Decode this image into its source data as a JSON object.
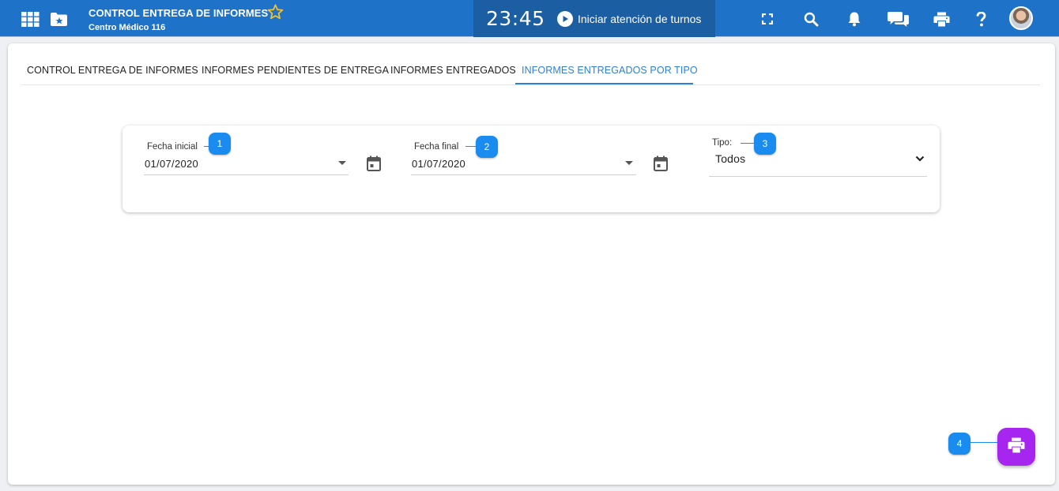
{
  "header": {
    "title": "CONTROL ENTREGA DE INFORMES",
    "subtitle": "Centro Médico 116",
    "clock": "23:45",
    "turnos_label": "Iniciar atención de turnos",
    "icons": [
      "apps-grid-icon",
      "folder-star-icon",
      "favorite-star-icon",
      "play-icon",
      "fullscreen-icon",
      "search-icon",
      "bell-icon",
      "chat-icon",
      "print-icon",
      "help-icon"
    ]
  },
  "tabs": [
    {
      "label": "CONTROL ENTREGA DE INFORMES",
      "active": false
    },
    {
      "label": "INFORMES PENDIENTES DE ENTREGA",
      "active": false
    },
    {
      "label": "INFORMES ENTREGADOS",
      "active": false
    },
    {
      "label": "INFORMES ENTREGADOS POR TIPO",
      "active": true
    }
  ],
  "filters": {
    "fecha_inicial": {
      "label": "Fecha inicial",
      "value": "01/07/2020",
      "badge": "1"
    },
    "fecha_final": {
      "label": "Fecha final",
      "value": "01/07/2020",
      "badge": "2"
    },
    "tipo": {
      "label": "Tipo:",
      "value": "Todos",
      "badge": "3"
    }
  },
  "fab": {
    "icon": "print-icon",
    "badge": "4"
  },
  "colors": {
    "topbar": "#1e73c8",
    "clock_block": "#1b5ea2",
    "active_tab": "#2f7fd0",
    "badge": "#1a8cf0",
    "fab": "#a626f0",
    "star": "#f4c430"
  }
}
